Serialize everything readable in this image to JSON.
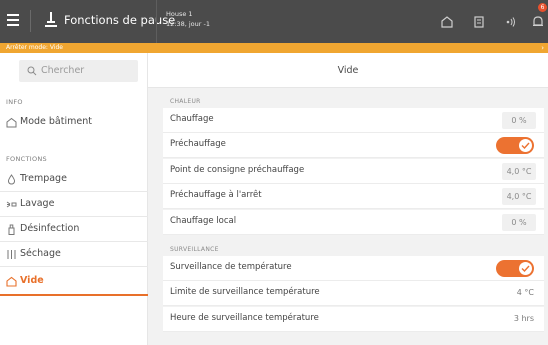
{
  "header": {
    "title": "Fonctions de pause",
    "house_name": "House 1",
    "house_time": "12:38, jour -1",
    "notification_count": "6"
  },
  "alert": {
    "text": "Arrêter mode: Vide",
    "arrow": "›"
  },
  "sidebar": {
    "search_placeholder": "Chercher",
    "info_label": "INFO",
    "info_items": [
      {
        "label": "Mode bâtiment",
        "icon": "house-icon"
      }
    ],
    "functions_label": "FONCTIONS",
    "function_items": [
      {
        "label": "Trempage",
        "icon": "droplet-icon"
      },
      {
        "label": "Lavage",
        "icon": "spray-icon"
      },
      {
        "label": "Désinfection",
        "icon": "bottle-icon"
      },
      {
        "label": "Séchage",
        "icon": "drying-icon"
      },
      {
        "label": "Vide",
        "icon": "house-icon",
        "active": true
      }
    ]
  },
  "main": {
    "title": "Vide",
    "groups": [
      {
        "label": "CHALEUR",
        "rows": [
          {
            "label": "Chauffage",
            "value": "0 %",
            "type": "value"
          },
          {
            "label": "Préchauffage",
            "type": "toggle",
            "on": true
          },
          {
            "label": "Point de consigne préchauffage",
            "value": "4,0 °C",
            "type": "value"
          },
          {
            "label": "Préchauffage à l'arrêt",
            "value": "4,0 °C",
            "type": "value"
          },
          {
            "label": "Chauffage local",
            "value": "0 %",
            "type": "value"
          }
        ]
      },
      {
        "label": "SURVEILLANCE",
        "rows": [
          {
            "label": "Surveillance de température",
            "type": "toggle",
            "on": true
          },
          {
            "label": "Limite de surveillance température",
            "value": "4 °C",
            "type": "text"
          },
          {
            "label": "Heure de surveillance température",
            "value": "3 hrs",
            "type": "text"
          }
        ]
      }
    ]
  },
  "colors": {
    "accent": "#e8702a",
    "toggle": "#ec7231",
    "topbar": "#4b4b4b",
    "alert": "#f0a631"
  }
}
